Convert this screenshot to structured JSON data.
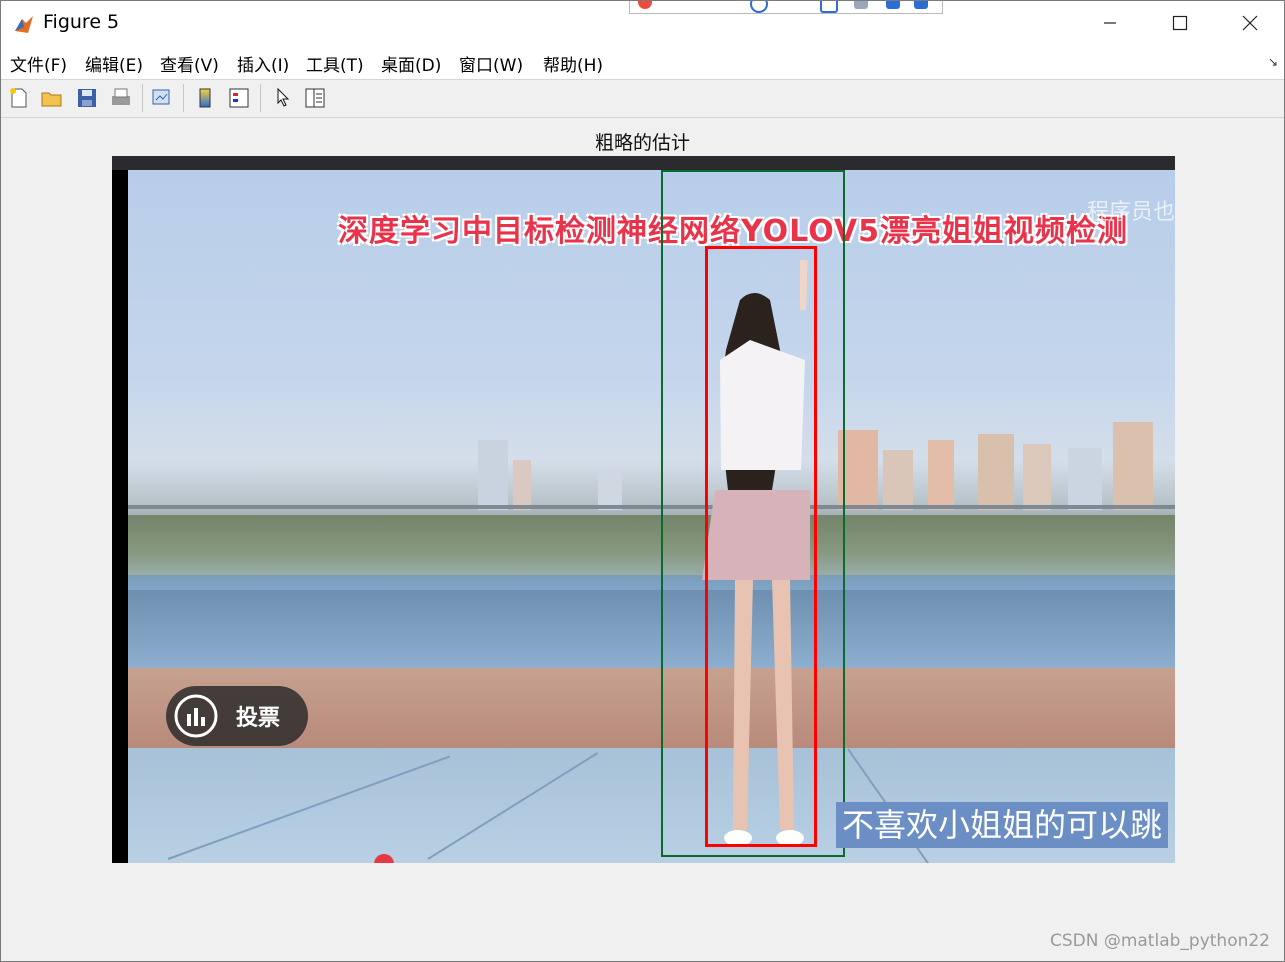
{
  "window": {
    "title": "Figure 5",
    "controls": {
      "minimize": "minimize-icon",
      "maximize": "maximize-icon",
      "close": "close-icon"
    }
  },
  "menu": {
    "items": [
      "文件(F)",
      "编辑(E)",
      "查看(V)",
      "插入(I)",
      "工具(T)",
      "桌面(D)",
      "窗口(W)",
      "帮助(H)"
    ]
  },
  "toolbar": {
    "buttons": [
      "new-figure-icon",
      "open-file-icon",
      "save-icon",
      "print-icon",
      "link-plot-icon",
      "colorbar-icon",
      "legend-icon",
      "edit-plot-icon",
      "property-inspector-icon"
    ]
  },
  "axes": {
    "title": "粗略的估计"
  },
  "image": {
    "banner": "深度学习中目标检测神经网络YOLOV5漂亮姐姐视频检测",
    "watermark_top": "程序员也",
    "subtitle": "不喜欢小姐姐的可以跳",
    "vote_label": "投票",
    "boxes": {
      "green": "#0b6b2a",
      "red": "#ff0000"
    }
  },
  "footer": {
    "credit": "CSDN @matlab_python22"
  }
}
